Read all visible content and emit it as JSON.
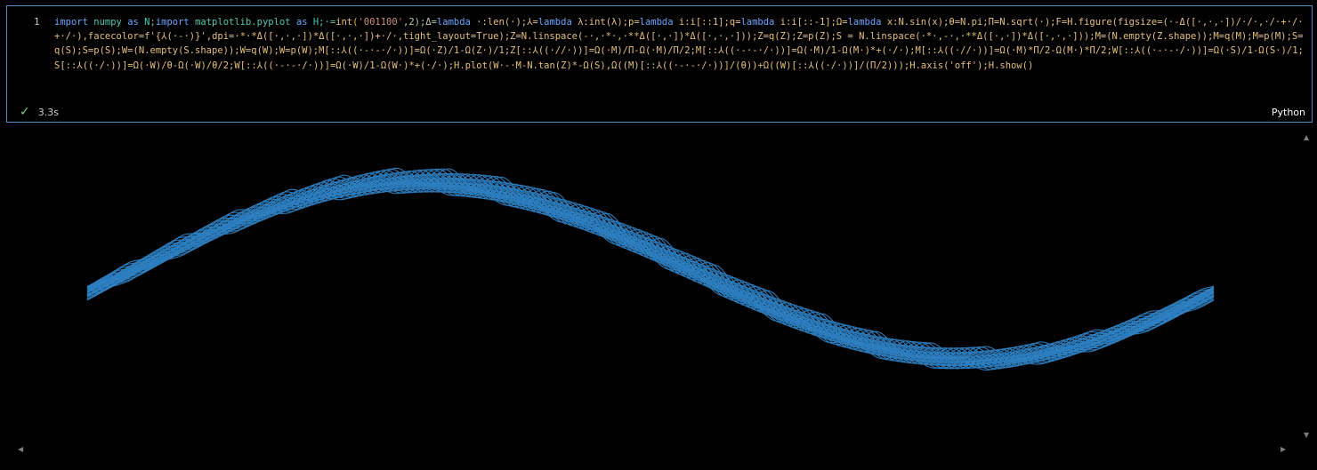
{
  "cell": {
    "line_number": "1",
    "code": [
      {
        "text": "import",
        "class": "kw"
      },
      {
        "text": " numpy ",
        "class": "mod"
      },
      {
        "text": "as",
        "class": "kw"
      },
      {
        "text": " N;",
        "class": "mod"
      },
      {
        "text": "import",
        "class": "kw"
      },
      {
        "text": " matplotlib.pyplot ",
        "class": "mod"
      },
      {
        "text": "as",
        "class": "kw"
      },
      {
        "text": " H;·=",
        "class": "mod"
      },
      {
        "text": "int",
        "class": "fn"
      },
      {
        "text": "(",
        "class": "punct"
      },
      {
        "text": "'001100'",
        "class": "str"
      },
      {
        "text": ",2);Δ=",
        "class": "num"
      },
      {
        "text": "lambda",
        "class": "kw"
      },
      {
        "text": " ·:len(·);⅄=",
        "class": "fn"
      },
      {
        "text": "lambda",
        "class": "kw"
      },
      {
        "text": " λ:int(λ);p=",
        "class": "fn"
      },
      {
        "text": "lambda",
        "class": "kw"
      },
      {
        "text": " i:i[::1];q=",
        "class": "fn"
      },
      {
        "text": "lambda",
        "class": "kw"
      },
      {
        "text": " i:i[::-1];Ω=",
        "class": "fn"
      },
      {
        "text": "lambda",
        "class": "kw"
      },
      {
        "text": " x:N.sin(x);θ=N.pi;Π=N.sqrt(·);F=H.figure(figsize=(·-Δ([·,·,·])/·/·,·/·+·/·+·/·),facecolor=f'{⅄(·-·)}',dpi=·*·*Δ([·,·,·])*Δ([·,·,·])+·/·,tight_layout=True);Z=N.linspace(-·,·*·,·**Δ([·,·])*Δ([·,·,·]));Z=q(Z);Z=p(Z);S = N.linspace(·*·,-·,·**Δ([·,·])*Δ([·,·,·]));M=(N.empty(Z.shape));M=q(M);M=p(M);S=q(S);S=p(S);W=(N.empty(S.shape));W=q(W);W=p(W);M[::⅄((·-·-·/·))]=Ω(·Z)/1-Ω(Z·)/1;Z[::⅄((·//·))]=Ω(·M)/Π-Ω(·M)/Π/2;M[::⅄((·-·-·/·))]=Ω(·M)/1-Ω(M·)*+(·/·);M[::⅄((·//·))]=Ω(·M)*Π/2-Ω(M·)*Π/2;W[::⅄((·-·-·/·))]=Ω(·S)/1-Ω(S·)/1;S[::⅄((·/·))]=Ω(·W)/θ-Ω(·W)/θ/2;W[::⅄((·-·-·/·))]=Ω(·W)/1-Ω(W·)*+(·/·);H.plot(W·-·M-N.tan(Z)*-Ω(S),Ω((M)[::⅄((·-·-·/·))]/(θ))+Ω((W)[::⅄((·/·))]/(Π/2)));H.axis('off');H.show()",
        "class": "fn"
      }
    ],
    "status_text": "3.3s",
    "language": "Python"
  },
  "output": {
    "plot_color": "#2d7fc1",
    "background": "#000000"
  },
  "icons": {
    "status": "check-icon",
    "scroll_up": "scroll-up-icon",
    "scroll_down": "scroll-down-icon",
    "scroll_left": "scroll-left-icon",
    "scroll_right": "scroll-right-icon"
  }
}
